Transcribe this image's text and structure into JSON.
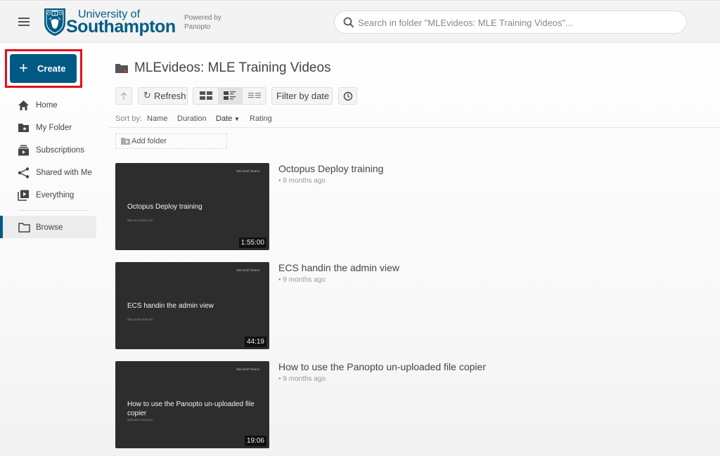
{
  "header": {
    "menu_icon": "hamburger-icon",
    "logo": {
      "line1": "University of",
      "line2": "Southampton"
    },
    "powered_by": {
      "line1": "Powered by",
      "line2": "Panopto"
    },
    "search": {
      "placeholder": "Search in folder \"MLEvideos: MLE Training Videos\"...",
      "value": ""
    }
  },
  "sidebar": {
    "create_label": "Create",
    "items": [
      {
        "label": "Home",
        "icon": "home-icon"
      },
      {
        "label": "My Folder",
        "icon": "my-folder-icon"
      },
      {
        "label": "Subscriptions",
        "icon": "subscriptions-icon"
      },
      {
        "label": "Shared with Me",
        "icon": "share-icon"
      },
      {
        "label": "Everything",
        "icon": "everything-icon"
      }
    ],
    "browse": {
      "label": "Browse",
      "icon": "folder-icon",
      "active": true
    }
  },
  "main": {
    "folder_title": "MLEvideos: MLE Training Videos",
    "toolbar": {
      "refresh_label": "Refresh",
      "filter_label": "Filter by date",
      "views": [
        "tiles",
        "detail",
        "list"
      ],
      "active_view": "detail"
    },
    "sort": {
      "label": "Sort by:",
      "options": [
        "Name",
        "Duration",
        "Date",
        "Rating"
      ],
      "active": "Date",
      "active_direction": "descending"
    },
    "add_folder_label": "Add folder",
    "videos": [
      {
        "title": "Octopus Deploy training",
        "age": "• 8 months ago",
        "duration": "1:55:00",
        "thumb_brand": "Microsoft Teams",
        "thumb_title": "Octopus Deploy training",
        "thumb_date": "2023-10-12 09:22 UTC"
      },
      {
        "title": "ECS handin the admin view",
        "age": "• 9 months ago",
        "duration": "44:19",
        "thumb_brand": "Microsoft Teams",
        "thumb_title": "ECS handin the admin view",
        "thumb_date": "2023-10-05 10:25 UTC"
      },
      {
        "title": "How to use the Panopto un-uploaded file copier",
        "age": "• 9 months ago",
        "duration": "19:06",
        "thumb_brand": "Microsoft Teams",
        "thumb_title": "How to use the Panopto un-uploaded file copier",
        "thumb_date": "2023-10-07 10:33 UTC"
      }
    ]
  },
  "colors": {
    "brand": "#005a83",
    "highlight": "#e0101e",
    "thumbnail_bg": "#2d2d2d"
  }
}
